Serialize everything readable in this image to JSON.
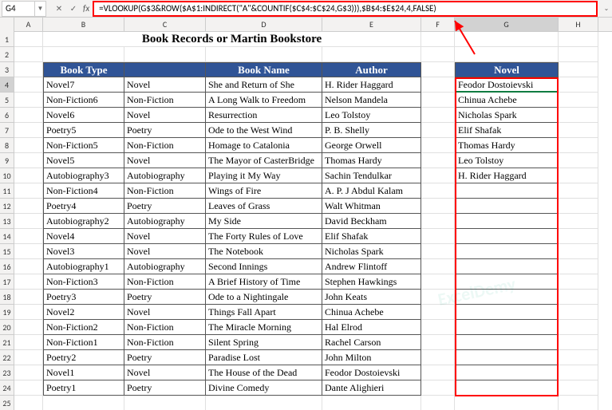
{
  "namebox": "G4",
  "formula": "=VLOOKUP(G$3&ROW($A$1:INDIRECT(\"A\"&COUNTIF($C$4:$C$24,G$3))),$B$4:$E$24,4,FALSE)",
  "title": "Book Records or Martin Bookstore",
  "headers": {
    "B": "Book Type",
    "D": "Book Name",
    "E": "Author",
    "G": "Novel"
  },
  "columns": [
    "A",
    "B",
    "C",
    "D",
    "E",
    "F",
    "G",
    "H"
  ],
  "rows": [
    {
      "b": "Novel7",
      "c": "Novel",
      "d": "She and Return of She",
      "e": "H. Rider Haggard",
      "g": "Feodor Dostoievski"
    },
    {
      "b": "Non-Fiction6",
      "c": "Non-Fiction",
      "d": "A Long Walk to Freedom",
      "e": "Nelson Mandela",
      "g": "Chinua Achebe"
    },
    {
      "b": "Novel6",
      "c": "Novel",
      "d": "Resurrection",
      "e": "Leo Tolstoy",
      "g": "Nicholas Spark"
    },
    {
      "b": "Poetry5",
      "c": "Poetry",
      "d": "Ode to the West Wind",
      "e": "P. B. Shelly",
      "g": "Elif Shafak"
    },
    {
      "b": "Non-Fiction5",
      "c": "Non-Fiction",
      "d": "Homage to Catalonia",
      "e": "George Orwell",
      "g": "Thomas Hardy"
    },
    {
      "b": "Novel5",
      "c": "Novel",
      "d": "The Mayor of CasterBridge",
      "e": "Thomas Hardy",
      "g": "Leo Tolstoy"
    },
    {
      "b": "Autobiography3",
      "c": "Autobiography",
      "d": "Playing it My Way",
      "e": "Sachin Tendulkar",
      "g": "H. Rider Haggard"
    },
    {
      "b": "Non-Fiction4",
      "c": "Non-Fiction",
      "d": "Wings of Fire",
      "e": "A. P. J Abdul Kalam",
      "g": ""
    },
    {
      "b": "Poetry4",
      "c": "Poetry",
      "d": "Leaves of Grass",
      "e": "Walt Whitman",
      "g": ""
    },
    {
      "b": "Autobiography2",
      "c": "Autobiography",
      "d": "My Side",
      "e": "David Beckham",
      "g": ""
    },
    {
      "b": "Novel4",
      "c": "Novel",
      "d": "The Forty Rules of Love",
      "e": "Elif Shafak",
      "g": ""
    },
    {
      "b": "Novel3",
      "c": "Novel",
      "d": "The Notebook",
      "e": "Nicholas Spark",
      "g": ""
    },
    {
      "b": "Autobiography1",
      "c": "Autobiography",
      "d": "Second Innings",
      "e": "Andrew Flintoff",
      "g": ""
    },
    {
      "b": "Non-Fiction3",
      "c": "Non-Fiction",
      "d": "A Brief History of Time",
      "e": "Stephen Hawkings",
      "g": ""
    },
    {
      "b": "Poetry3",
      "c": "Poetry",
      "d": "Ode to a Nightingale",
      "e": "John Keats",
      "g": ""
    },
    {
      "b": "Novel2",
      "c": "Novel",
      "d": "Things Fall Apart",
      "e": "Chinua Achebe",
      "g": ""
    },
    {
      "b": "Non-Fiction2",
      "c": "Non-Fiction",
      "d": "The Miracle Morning",
      "e": "Hal Elrod",
      "g": ""
    },
    {
      "b": "Non-Fiction1",
      "c": "Non-Fiction",
      "d": "Silent Spring",
      "e": "Rachel Carson",
      "g": ""
    },
    {
      "b": "Poetry2",
      "c": "Poetry",
      "d": "Paradise Lost",
      "e": "John Milton",
      "g": ""
    },
    {
      "b": "Novel1",
      "c": "Novel",
      "d": "The House of the Dead",
      "e": "Feodor Dostoievski",
      "g": ""
    },
    {
      "b": "Poetry1",
      "c": "Poetry",
      "d": "Divine Comedy",
      "e": "Dante Alighieri",
      "g": ""
    }
  ]
}
